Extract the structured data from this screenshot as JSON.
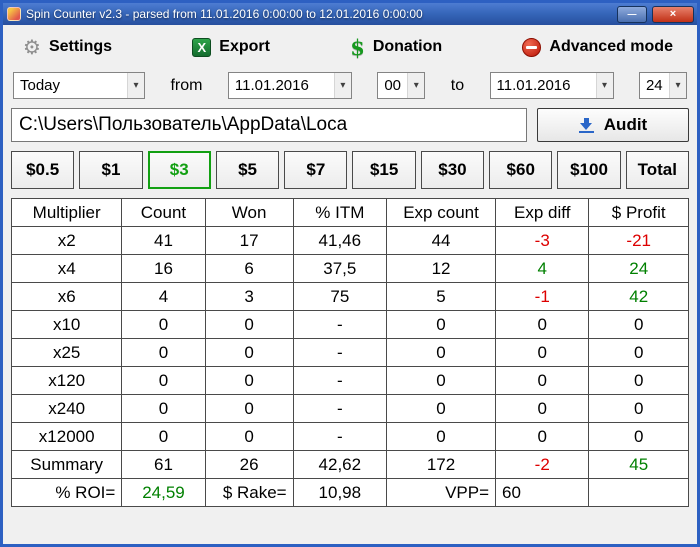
{
  "window": {
    "title": "Spin Counter v2.3 - parsed from 11.01.2016 0:00:00 to 12.01.2016 0:00:00"
  },
  "icons": {
    "gear": "⚙",
    "excel": "X",
    "dollar": "$",
    "dropdown": "▾",
    "minimize": "—",
    "close": "×"
  },
  "toolbar": {
    "settings": "Settings",
    "export": "Export",
    "donation": "Donation",
    "advanced_mode": "Advanced mode"
  },
  "filters": {
    "period": "Today",
    "from_label": "from",
    "from_date": "11.01.2016",
    "from_hour": "00",
    "to_label": "to",
    "to_date": "11.01.2016",
    "to_hour": "24"
  },
  "path": {
    "value": "C:\\Users\\Пользователь\\AppData\\Loca",
    "audit_label": "Audit"
  },
  "tabs": {
    "items": [
      {
        "label": "$0.5",
        "selected": false
      },
      {
        "label": "$1",
        "selected": false
      },
      {
        "label": "$3",
        "selected": true
      },
      {
        "label": "$5",
        "selected": false
      },
      {
        "label": "$7",
        "selected": false
      },
      {
        "label": "$15",
        "selected": false
      },
      {
        "label": "$30",
        "selected": false
      },
      {
        "label": "$60",
        "selected": false
      },
      {
        "label": "$100",
        "selected": false
      },
      {
        "label": "Total",
        "selected": false
      }
    ]
  },
  "colors": {
    "neg": "#dd0000",
    "pos": "#008000"
  },
  "table": {
    "headers": [
      "Multiplier",
      "Count",
      "Won",
      "% ITM",
      "Exp count",
      "Exp diff",
      "$ Profit"
    ],
    "rows": [
      {
        "cells": [
          "x2",
          "41",
          "17",
          "41,46",
          "44",
          "-3",
          "-21"
        ],
        "colors": [
          null,
          null,
          null,
          null,
          null,
          "neg",
          "neg"
        ]
      },
      {
        "cells": [
          "x4",
          "16",
          "6",
          "37,5",
          "12",
          "4",
          "24"
        ],
        "colors": [
          null,
          null,
          null,
          null,
          null,
          "pos",
          "pos"
        ]
      },
      {
        "cells": [
          "x6",
          "4",
          "3",
          "75",
          "5",
          "-1",
          "42"
        ],
        "colors": [
          null,
          null,
          null,
          null,
          null,
          "neg",
          "pos"
        ]
      },
      {
        "cells": [
          "x10",
          "0",
          "0",
          "-",
          "0",
          "0",
          "0"
        ],
        "colors": []
      },
      {
        "cells": [
          "x25",
          "0",
          "0",
          "-",
          "0",
          "0",
          "0"
        ],
        "colors": []
      },
      {
        "cells": [
          "x120",
          "0",
          "0",
          "-",
          "0",
          "0",
          "0"
        ],
        "colors": []
      },
      {
        "cells": [
          "x240",
          "0",
          "0",
          "-",
          "0",
          "0",
          "0"
        ],
        "colors": []
      },
      {
        "cells": [
          "x12000",
          "0",
          "0",
          "-",
          "0",
          "0",
          "0"
        ],
        "colors": []
      },
      {
        "cells": [
          "Summary",
          "61",
          "26",
          "42,62",
          "172",
          "-2",
          "45"
        ],
        "colors": [
          null,
          null,
          null,
          null,
          null,
          "neg",
          "pos"
        ]
      }
    ],
    "footer": [
      {
        "text": "% ROI=",
        "align": "right"
      },
      {
        "text": "24,59",
        "color": "pos"
      },
      {
        "text": "$ Rake=",
        "align": "right"
      },
      {
        "text": "10,98"
      },
      {
        "text": "VPP=",
        "align": "right"
      },
      {
        "text": "60",
        "align": "left"
      },
      {
        "text": ""
      }
    ]
  }
}
